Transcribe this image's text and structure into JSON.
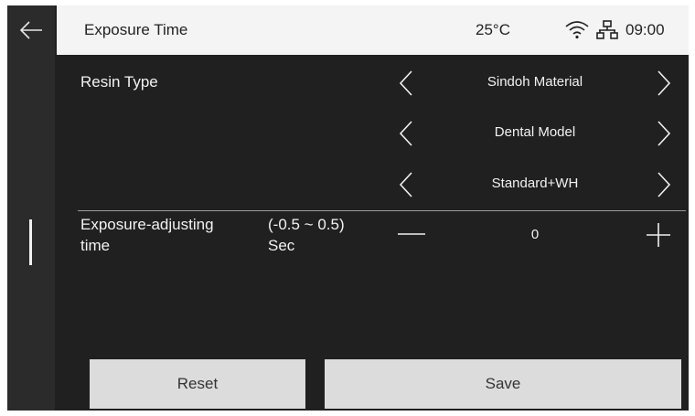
{
  "header": {
    "title": "Exposure Time",
    "temperature": "25°C",
    "time": "09:00",
    "icons": [
      "back-arrow-icon",
      "wifi-icon",
      "network-icon"
    ]
  },
  "resin": {
    "label": "Resin Type",
    "options": [
      {
        "value": "Sindoh Material"
      },
      {
        "value": "Dental Model"
      },
      {
        "value": "Standard+WH"
      }
    ]
  },
  "exposure": {
    "label_line1": "Exposure-adjusting",
    "label_line2": "time",
    "range": "(-0.5 ~ 0.5)",
    "unit": "Sec",
    "value": "0"
  },
  "buttons": {
    "reset": "Reset",
    "save": "Save"
  },
  "colors": {
    "background": "#202020",
    "header": "#f4f4f4",
    "button": "#dcdcdc",
    "text_light": "#f2f2f2"
  }
}
